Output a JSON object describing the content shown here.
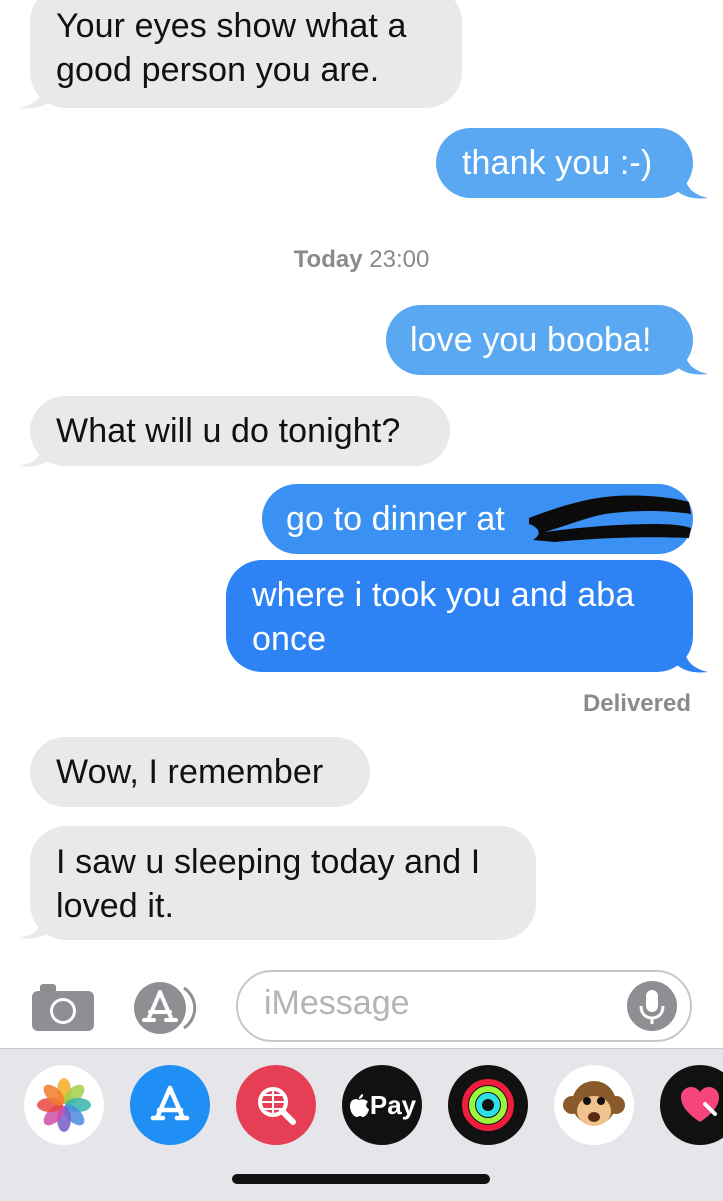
{
  "messages": [
    {
      "direction": "received",
      "lines": [
        "Your eyes show what a",
        "good person you are."
      ]
    },
    {
      "direction": "sent",
      "lines": [
        "thank you :-)"
      ]
    },
    {
      "direction": "sent",
      "lines": [
        "love you booba!"
      ]
    },
    {
      "direction": "received",
      "lines": [
        "What will u do tonight?"
      ]
    },
    {
      "direction": "sent",
      "lines": [
        "go to dinner at"
      ]
    },
    {
      "direction": "sent",
      "lines": [
        "where i took you and aba",
        "once"
      ]
    },
    {
      "direction": "received",
      "lines": [
        "Wow, I remember"
      ]
    },
    {
      "direction": "received",
      "lines": [
        "I saw u sleeping today and I",
        "loved it."
      ]
    }
  ],
  "timestamp": {
    "day": "Today",
    "time": "23:00"
  },
  "status": "Delivered",
  "input": {
    "placeholder": "iMessage"
  },
  "app_drawer": {
    "apps": [
      "photos-icon",
      "app-store-icon",
      "web-image-search-icon",
      "apple-pay-icon",
      "activity-icon",
      "animoji-icon",
      "digital-touch-icon"
    ],
    "apple_pay_label": "Pay"
  },
  "colors": {
    "received_bubble": "#e9e9eb",
    "sent_bubble": "#3b91f3",
    "muted_text": "#8a8a8e",
    "drawer_bg": "#e5e5ea"
  }
}
